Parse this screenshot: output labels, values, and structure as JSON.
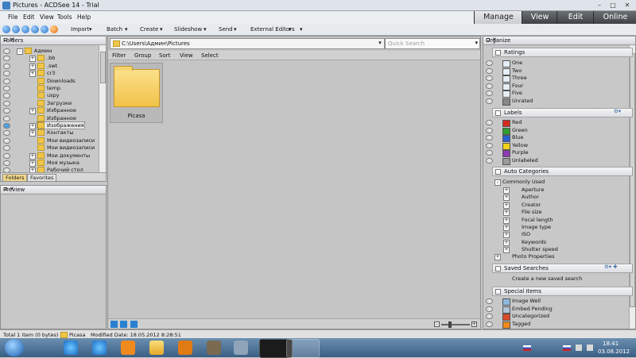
{
  "window": {
    "title": "Pictures - ACDSee 14 - Trial"
  },
  "menu": [
    "File",
    "Edit",
    "View",
    "Tools",
    "Help"
  ],
  "modes": [
    "Manage",
    "View",
    "Edit",
    "Online"
  ],
  "toolbar": [
    "Import",
    "Batch",
    "Create",
    "Slideshow",
    "Send",
    "External Editors"
  ],
  "folders_panel": {
    "title": "Folders",
    "items": [
      "Админ",
      ".bb",
      ".swt",
      "cr3",
      "Downloads",
      "temp",
      "uspy",
      "Загрузки",
      "Избранное",
      "Избранное",
      "Изображения",
      "Контакты",
      "Мои видеозаписи",
      "Мои видеозаписи",
      "Мои документы",
      "Моя музыка",
      "Рабочий стол"
    ],
    "tabs": [
      "Folders",
      "Favorites"
    ]
  },
  "preview_panel": {
    "title": "Preview"
  },
  "content": {
    "path": "C:\\Users\\Админ\\Pictures",
    "search_placeholder": "Quick Search",
    "filters": [
      "Filter",
      "Group",
      "Sort",
      "View",
      "Select"
    ],
    "items": [
      {
        "label": "Picasa"
      }
    ]
  },
  "organize": {
    "title": "Organize",
    "ratings": {
      "title": "Ratings",
      "items": [
        "One",
        "Two",
        "Three",
        "Four",
        "Five",
        "Unrated"
      ]
    },
    "labels": {
      "title": "Labels",
      "items": [
        {
          "name": "Red",
          "color": "#d42a20"
        },
        {
          "name": "Green",
          "color": "#2f9e2f"
        },
        {
          "name": "Blue",
          "color": "#2a5fd0"
        },
        {
          "name": "Yellow",
          "color": "#f2d21c"
        },
        {
          "name": "Purple",
          "color": "#8a3bb0"
        },
        {
          "name": "Unlabeled",
          "color": "#9a9a9a"
        }
      ]
    },
    "auto_categories": {
      "title": "Auto Categories",
      "group": "Commonly Used",
      "items": [
        "Aperture",
        "Author",
        "Creator",
        "File size",
        "Focal length",
        "Image type",
        "ISO",
        "Keywords",
        "Shutter speed"
      ],
      "extra": "Photo Properties"
    },
    "saved_searches": {
      "title": "Saved Searches",
      "create": "Create a new saved search"
    },
    "special_items": {
      "title": "Special Items",
      "items": [
        "Image Well",
        "Embed Pending",
        "Uncategorized",
        "Tagged"
      ]
    }
  },
  "status": {
    "total": "Total 1 item  (0 bytes)",
    "item": "Picasa",
    "modified": "Modified Date: 18.05.2012 8:28:51"
  },
  "taskbar": {
    "time": "18:41",
    "date": "03.08.2012"
  }
}
